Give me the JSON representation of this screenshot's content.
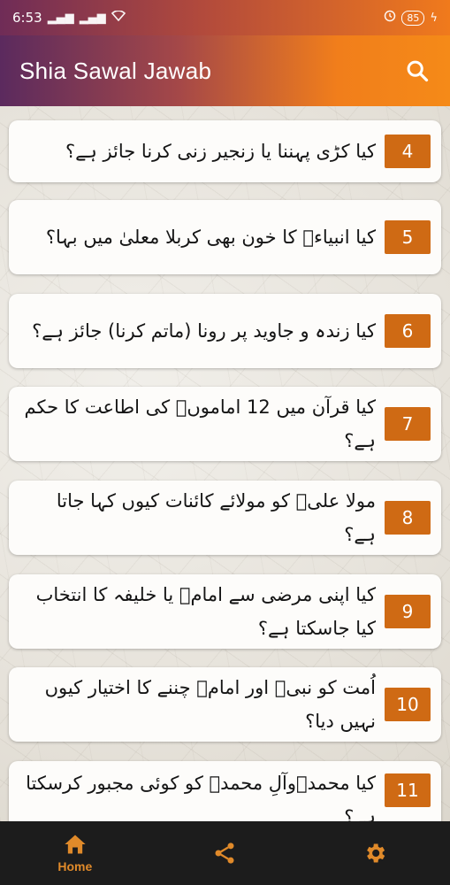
{
  "status_bar": {
    "time": "6:53",
    "battery": "85"
  },
  "app_bar": {
    "title": "Shia Sawal Jawab"
  },
  "items": [
    {
      "number": "4",
      "text": "کیا کڑی پہننا یا زنجیر زنی کرنا جائز ہے؟"
    },
    {
      "number": "5",
      "text": "کیا انبیاءؑ کا خون بھی کربلا معلیٰ میں بہا؟"
    },
    {
      "number": "6",
      "text": "کیا زندہ و جاوید پر رونا (ماتم کرنا) جائز ہے؟"
    },
    {
      "number": "7",
      "text": "کیا قرآن میں 12 اماموںؑ کی اطاعت کا حکم ہے؟"
    },
    {
      "number": "8",
      "text": "مولا علیؑ کو مولائے کائنات کیوں کہا جاتا ہے؟"
    },
    {
      "number": "9",
      "text": "کیا اپنی مرضی سے امامؑ یا خلیفہ کا انتخاب کیا جاسکتا ہے؟"
    },
    {
      "number": "10",
      "text": "اُمت کو نبیؐ اور امامؑ چننے کا اختیار کیوں نہیں دیا؟"
    },
    {
      "number": "11",
      "text": "کیا محمدؐوآلِ محمدؐ کو کوئی مجبور کرسکتا ہے؟"
    }
  ],
  "bottom_nav": {
    "home_label": "Home"
  },
  "colors": {
    "accent": "#cf6a14",
    "nav_active": "#e08a2a",
    "nav_bg": "#1c1c1c"
  }
}
